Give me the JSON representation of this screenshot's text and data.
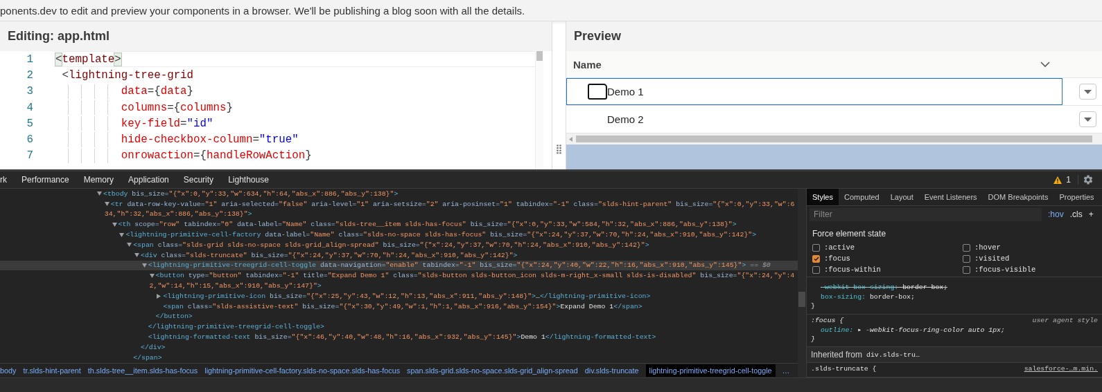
{
  "banner": {
    "text": "ponents.dev to edit and preview your components in a browser. We'll be publishing a blog soon with all the details."
  },
  "editor": {
    "title": "Editing: app.html",
    "lines": [
      {
        "number": "1",
        "kind": "start",
        "current": true,
        "tokens": [
          {
            "kind": "bracket",
            "text": "<"
          },
          {
            "kind": "tag",
            "text": "template"
          },
          {
            "kind": "bracket",
            "text": ">"
          }
        ]
      },
      {
        "number": "2",
        "kind": "start",
        "current": false,
        "tokens": [
          {
            "kind": "punct",
            "text": " <"
          },
          {
            "kind": "tag",
            "text": "lightning-tree-grid"
          }
        ]
      },
      {
        "number": "3",
        "kind": "continuation",
        "current": false,
        "tokens": [
          {
            "kind": "attr",
            "text": "data"
          },
          {
            "kind": "punct",
            "text": "={"
          },
          {
            "kind": "expr",
            "text": "data"
          },
          {
            "kind": "punct",
            "text": "}"
          }
        ]
      },
      {
        "number": "4",
        "kind": "continuation",
        "current": false,
        "tokens": [
          {
            "kind": "attr",
            "text": "columns"
          },
          {
            "kind": "punct",
            "text": "={"
          },
          {
            "kind": "expr",
            "text": "columns"
          },
          {
            "kind": "punct",
            "text": "}"
          }
        ]
      },
      {
        "number": "5",
        "kind": "continuation",
        "current": false,
        "tokens": [
          {
            "kind": "attr",
            "text": "key-field"
          },
          {
            "kind": "punct",
            "text": "="
          },
          {
            "kind": "string",
            "text": "\"id\""
          }
        ]
      },
      {
        "number": "6",
        "kind": "continuation",
        "current": false,
        "tokens": [
          {
            "kind": "attr",
            "text": "hide-checkbox-column"
          },
          {
            "kind": "punct",
            "text": "="
          },
          {
            "kind": "string",
            "text": "\"true\""
          }
        ]
      },
      {
        "number": "7",
        "kind": "continuation",
        "current": false,
        "tokens": [
          {
            "kind": "attr",
            "text": "onrowaction"
          },
          {
            "kind": "punct",
            "text": "={"
          },
          {
            "kind": "expr",
            "text": "handleRowAction"
          },
          {
            "kind": "punct",
            "text": "}"
          }
        ]
      }
    ]
  },
  "preview": {
    "title": "Preview",
    "column": {
      "label": "Name"
    },
    "rows": [
      {
        "label": "Demo 1",
        "focused": true
      },
      {
        "label": "Demo 2",
        "focused": false
      }
    ]
  },
  "devtools": {
    "tabs": [
      "rk",
      "Performance",
      "Memory",
      "Application",
      "Security",
      "Lighthouse"
    ],
    "warnings": "1",
    "elements": [
      {
        "expanded": true,
        "selected": false,
        "line": [
          {
            "kind": "tag",
            "text": "<tbody"
          },
          {
            "kind": "attr",
            "text": " bis_size="
          },
          {
            "kind": "value",
            "text": "\"{\"x\":0,\"y\":33,\"w\":634,\"h\":64,\"abs_x\":886,\"abs_y\":138}\""
          },
          {
            "kind": "tag",
            "text": ">"
          }
        ],
        "children": [
          {
            "expanded": true,
            "selected": false,
            "line": [
              {
                "kind": "tag",
                "text": "<tr"
              },
              {
                "kind": "attr",
                "text": " data-row-key-value="
              },
              {
                "kind": "value",
                "text": "\"1\""
              },
              {
                "kind": "attr",
                "text": " aria-selected="
              },
              {
                "kind": "value",
                "text": "\"false\""
              },
              {
                "kind": "attr",
                "text": " aria-level="
              },
              {
                "kind": "value",
                "text": "\"1\""
              },
              {
                "kind": "attr",
                "text": " aria-setsize="
              },
              {
                "kind": "value",
                "text": "\"2\""
              },
              {
                "kind": "attr",
                "text": " aria-posinset="
              },
              {
                "kind": "value",
                "text": "\"1\""
              },
              {
                "kind": "attr",
                "text": " tabindex="
              },
              {
                "kind": "value",
                "text": "\"-1\""
              },
              {
                "kind": "attr",
                "text": " class="
              },
              {
                "kind": "value",
                "text": "\"slds-hint-parent\""
              },
              {
                "kind": "attr",
                "text": " bis_size="
              },
              {
                "kind": "value",
                "text": "\"{\"x\":0,\"y\":33,\"w\":6"
              }
            ],
            "wrap": [
              {
                "kind": "value",
                "text": "34,\"h\":32,\"abs_x\":886,\"abs_y\":138}\""
              },
              {
                "kind": "tag",
                "text": ">"
              }
            ],
            "children": [
              {
                "expanded": true,
                "selected": false,
                "line": [
                  {
                    "kind": "tag",
                    "text": "<th"
                  },
                  {
                    "kind": "attr",
                    "text": " scope="
                  },
                  {
                    "kind": "value",
                    "text": "\"row\""
                  },
                  {
                    "kind": "attr",
                    "text": " tabindex="
                  },
                  {
                    "kind": "value",
                    "text": "\"0\""
                  },
                  {
                    "kind": "attr",
                    "text": " data-label="
                  },
                  {
                    "kind": "value",
                    "text": "\"Name\""
                  },
                  {
                    "kind": "attr",
                    "text": " class="
                  },
                  {
                    "kind": "value",
                    "text": "\"slds-tree__item slds-has-focus\""
                  },
                  {
                    "kind": "attr",
                    "text": " bis_size="
                  },
                  {
                    "kind": "value",
                    "text": "\"{\"x\":0,\"y\":33,\"w\":584,\"h\":32,\"abs_x\":886,\"abs_y\":138}\""
                  },
                  {
                    "kind": "tag",
                    "text": ">"
                  }
                ],
                "children": [
                  {
                    "expanded": true,
                    "selected": false,
                    "line": [
                      {
                        "kind": "tag",
                        "text": "<lightning-primitive-cell-factory"
                      },
                      {
                        "kind": "attr",
                        "text": " data-label="
                      },
                      {
                        "kind": "value",
                        "text": "\"Name\""
                      },
                      {
                        "kind": "attr",
                        "text": " class="
                      },
                      {
                        "kind": "value",
                        "text": "\"slds-no-space slds-has-focus\""
                      },
                      {
                        "kind": "attr",
                        "text": " bis_size="
                      },
                      {
                        "kind": "value",
                        "text": "\"{\"x\":24,\"y\":37,\"w\":70,\"h\":24,\"abs_x\":910,\"abs_y\":142}\""
                      },
                      {
                        "kind": "tag",
                        "text": ">"
                      }
                    ],
                    "children": [
                      {
                        "expanded": true,
                        "selected": false,
                        "line": [
                          {
                            "kind": "tag",
                            "text": "<span"
                          },
                          {
                            "kind": "attr",
                            "text": " class="
                          },
                          {
                            "kind": "value",
                            "text": "\"slds-grid slds-no-space slds-grid_align-spread\""
                          },
                          {
                            "kind": "attr",
                            "text": " bis_size="
                          },
                          {
                            "kind": "value",
                            "text": "\"{\"x\":24,\"y\":37,\"w\":70,\"h\":24,\"abs_x\":910,\"abs_y\":142}\""
                          },
                          {
                            "kind": "tag",
                            "text": ">"
                          }
                        ],
                        "close": [
                          {
                            "kind": "tag",
                            "text": "</span>"
                          }
                        ],
                        "children": [
                          {
                            "expanded": true,
                            "selected": false,
                            "line": [
                              {
                                "kind": "tag",
                                "text": "<div"
                              },
                              {
                                "kind": "attr",
                                "text": " class="
                              },
                              {
                                "kind": "value",
                                "text": "\"slds-truncate\""
                              },
                              {
                                "kind": "attr",
                                "text": " bis_size="
                              },
                              {
                                "kind": "value",
                                "text": "\"{\"x\":24,\"y\":37,\"w\":70,\"h\":24,\"abs_x\":910,\"abs_y\":142}\""
                              },
                              {
                                "kind": "tag",
                                "text": ">"
                              }
                            ],
                            "close": [
                              {
                                "kind": "tag",
                                "text": "</div>"
                              }
                            ],
                            "children": [
                              {
                                "expanded": true,
                                "selected": true,
                                "line": [
                                  {
                                    "kind": "tag",
                                    "text": "<lightning-primitive-treegrid-cell-toggle"
                                  },
                                  {
                                    "kind": "attr",
                                    "text": " data-navigation="
                                  },
                                  {
                                    "kind": "value",
                                    "text": "\"enable\""
                                  },
                                  {
                                    "kind": "attr",
                                    "text": " tabindex="
                                  },
                                  {
                                    "kind": "value",
                                    "text": "\"-1\""
                                  },
                                  {
                                    "kind": "attr",
                                    "text": " bis_size="
                                  },
                                  {
                                    "kind": "value",
                                    "text": "\"{\"x\":24,\"y\":40,\"w\":22,\"h\":16,\"abs_x\":910,\"abs_y\":145}\""
                                  },
                                  {
                                    "kind": "tag",
                                    "text": ">"
                                  },
                                  {
                                    "kind": "meta",
                                    "text": " == $0"
                                  }
                                ],
                                "close": [
                                  {
                                    "kind": "tag",
                                    "text": "</lightning-primitive-treegrid-cell-toggle>"
                                  }
                                ],
                                "children": [
                                  {
                                    "expanded": true,
                                    "selected": false,
                                    "line": [
                                      {
                                        "kind": "tag",
                                        "text": "<button"
                                      },
                                      {
                                        "kind": "attr",
                                        "text": " type="
                                      },
                                      {
                                        "kind": "value",
                                        "text": "\"button\""
                                      },
                                      {
                                        "kind": "attr",
                                        "text": " tabindex="
                                      },
                                      {
                                        "kind": "value",
                                        "text": "\"-1\""
                                      },
                                      {
                                        "kind": "attr",
                                        "text": " title="
                                      },
                                      {
                                        "kind": "value",
                                        "text": "\"Expand Demo 1\""
                                      },
                                      {
                                        "kind": "attr",
                                        "text": " class="
                                      },
                                      {
                                        "kind": "value",
                                        "text": "\"slds-button slds-button_icon slds-m-right_x-small slds-is-disabled\""
                                      },
                                      {
                                        "kind": "attr",
                                        "text": " bis_size="
                                      },
                                      {
                                        "kind": "value",
                                        "text": "\"{\"x\":24,\"y\":4"
                                      }
                                    ],
                                    "wrap": [
                                      {
                                        "kind": "value",
                                        "text": "2,\"w\":14,\"h\":15,\"abs_x\":910,\"abs_y\":147}\""
                                      },
                                      {
                                        "kind": "tag",
                                        "text": ">"
                                      }
                                    ],
                                    "close": [
                                      {
                                        "kind": "tag",
                                        "text": "</button>"
                                      }
                                    ],
                                    "children": [
                                      {
                                        "expanded": false,
                                        "selected": false,
                                        "line": [
                                          {
                                            "kind": "tag",
                                            "text": "<lightning-primitive-icon"
                                          },
                                          {
                                            "kind": "attr",
                                            "text": " bis_size="
                                          },
                                          {
                                            "kind": "value",
                                            "text": "\"{\"x\":25,\"y\":43,\"w\":12,\"h\":13,\"abs_x\":911,\"abs_y\":148}\""
                                          },
                                          {
                                            "kind": "tag",
                                            "text": ">"
                                          },
                                          {
                                            "kind": "text",
                                            "text": "…"
                                          },
                                          {
                                            "kind": "tag",
                                            "text": "</lightning-primitive-icon>"
                                          }
                                        ]
                                      },
                                      {
                                        "selected": false,
                                        "line": [
                                          {
                                            "kind": "tag",
                                            "text": "<span"
                                          },
                                          {
                                            "kind": "attr",
                                            "text": " class="
                                          },
                                          {
                                            "kind": "value",
                                            "text": "\"slds-assistive-text\""
                                          },
                                          {
                                            "kind": "attr",
                                            "text": " bis_size="
                                          },
                                          {
                                            "kind": "value",
                                            "text": "\"{\"x\":30,\"y\":49,\"w\":1,\"h\":1,\"abs_x\":916,\"abs_y\":154}\""
                                          },
                                          {
                                            "kind": "tag",
                                            "text": ">"
                                          },
                                          {
                                            "kind": "text",
                                            "text": "Expand Demo 1"
                                          },
                                          {
                                            "kind": "tag",
                                            "text": "</span>"
                                          }
                                        ]
                                      }
                                    ]
                                  }
                                ]
                              },
                              {
                                "selected": false,
                                "line": [
                                  {
                                    "kind": "tag",
                                    "text": "<lightning-formatted-text"
                                  },
                                  {
                                    "kind": "attr",
                                    "text": " bis_size="
                                  },
                                  {
                                    "kind": "value",
                                    "text": "\"{\"x\":46,\"y\":40,\"w\":48,\"h\":16,\"abs_x\":932,\"abs_y\":145}\""
                                  },
                                  {
                                    "kind": "tag",
                                    "text": ">"
                                  },
                                  {
                                    "kind": "text",
                                    "text": "Demo 1"
                                  },
                                  {
                                    "kind": "tag",
                                    "text": "</lightning-formatted-text>"
                                  }
                                ]
                              }
                            ]
                          }
                        ]
                      }
                    ]
                  }
                ]
              }
            ]
          }
        ]
      }
    ],
    "breadcrumbs": [
      {
        "label": "body",
        "selected": false
      },
      {
        "label": "tr.slds-hint-parent",
        "selected": false
      },
      {
        "label": "th.slds-tree__item.slds-has-focus",
        "selected": false
      },
      {
        "label": "lightning-primitive-cell-factory.slds-no-space.slds-has-focus",
        "selected": false
      },
      {
        "label": "span.slds-grid.slds-no-space.slds-grid_align-spread",
        "selected": false
      },
      {
        "label": "div.slds-truncate",
        "selected": false
      },
      {
        "label": "lightning-primitive-treegrid-cell-toggle",
        "selected": true
      },
      {
        "label": "…",
        "selected": false
      }
    ],
    "styles": {
      "tabs": [
        {
          "label": "Styles",
          "selected": true
        },
        {
          "label": "Computed",
          "selected": false
        },
        {
          "label": "Layout",
          "selected": false
        },
        {
          "label": "Event Listeners",
          "selected": false
        },
        {
          "label": "DOM Breakpoints",
          "selected": false
        },
        {
          "label": "Properties",
          "selected": false
        }
      ],
      "filter": {
        "placeholder": "Filter"
      },
      "actions": [
        ":hov",
        ".cls",
        "+"
      ],
      "force_state": {
        "title": "Force element state",
        "states": [
          {
            "label": ":active",
            "checked": false
          },
          {
            "label": ":hover",
            "checked": false
          },
          {
            "label": ":focus",
            "checked": true
          },
          {
            "label": ":visited",
            "checked": false
          },
          {
            "label": ":focus-within",
            "checked": false
          },
          {
            "label": ":focus-visible",
            "checked": false
          }
        ]
      },
      "rules": [
        {
          "kind": "rule",
          "user_agent": false,
          "declarations": [
            {
              "name": "-webkit-box-sizing:",
              "value": "border-box;",
              "overridden": true
            },
            {
              "name": "box-sizing:",
              "value": "border-box;",
              "overridden": false
            }
          ],
          "close": "}"
        },
        {
          "kind": "rule",
          "user_agent": true,
          "selector": ":focus {",
          "source": "user agent style",
          "declarations": [
            {
              "name": "outline:",
              "expander": "▸",
              "value": "-webkit-focus-ring-color auto 1px;",
              "overridden": false
            }
          ],
          "close": "}"
        },
        {
          "kind": "inherited",
          "label": "Inherited from",
          "element": "div.slds-tru…"
        },
        {
          "kind": "rule",
          "user_agent": false,
          "selector": ".slds-truncate {",
          "source": "salesforce-…m.min."
        }
      ]
    }
  }
}
